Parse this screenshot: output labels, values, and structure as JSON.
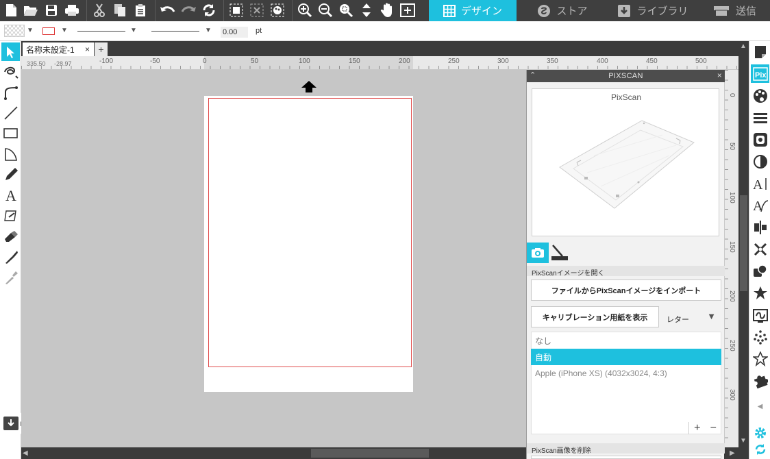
{
  "nav_tabs": [
    {
      "label": "デザイン",
      "icon": "grid-icon",
      "active": true
    },
    {
      "label": "ストア",
      "icon": "store-icon",
      "active": false
    },
    {
      "label": "ライブラリ",
      "icon": "library-icon",
      "active": false
    },
    {
      "label": "送信",
      "icon": "send-icon",
      "active": false
    }
  ],
  "toolbar_icons": [
    "new-document-icon",
    "open-folder-icon",
    "save-icon",
    "print-icon",
    "cut-icon",
    "copy-icon",
    "paste-icon",
    "undo-icon",
    "redo-icon",
    "refresh-icon",
    "select-all-icon",
    "deselect-icon",
    "edit-selection-icon",
    "zoom-in-icon",
    "zoom-out-icon",
    "zoom-select-icon",
    "pan-move-icon",
    "hand-icon",
    "fit-to-page-icon"
  ],
  "propbar": {
    "line_width": "0.00",
    "unit": "pt"
  },
  "document": {
    "tab_title": "名称未設定-1",
    "add_tab": "+"
  },
  "ruler": {
    "coord_x": "335.50",
    "coord_y": "-28.97",
    "ticks": [
      "-100",
      "-50",
      "0",
      "50",
      "100",
      "150",
      "200",
      "250",
      "300",
      "350",
      "400",
      "450",
      "500"
    ],
    "vticks": [
      "0",
      "50",
      "100",
      "150",
      "200",
      "250",
      "300"
    ]
  },
  "pixscan": {
    "panel_title": "PIXSCAN",
    "preview_title": "PixScan",
    "section_open": "PixScanイメージを開く",
    "import_button": "ファイルからPixScanイメージをインポート",
    "calibration_button": "キャリブレーション用紙を表示",
    "paper_size": "レター",
    "camera_options": [
      {
        "label": "なし",
        "selected": false
      },
      {
        "label": "自動",
        "selected": true
      },
      {
        "label": "Apple (iPhone XS) (4032x3024, 4:3)",
        "selected": false
      }
    ],
    "add_label": "+",
    "remove_label": "−",
    "section_delete": "PixScan画像を削除"
  },
  "colors": {
    "accent": "#1ec0de",
    "toolbar_bg": "#3f3f3f",
    "canvas": "#c6c6c6",
    "cut_line": "#e04b4b"
  }
}
